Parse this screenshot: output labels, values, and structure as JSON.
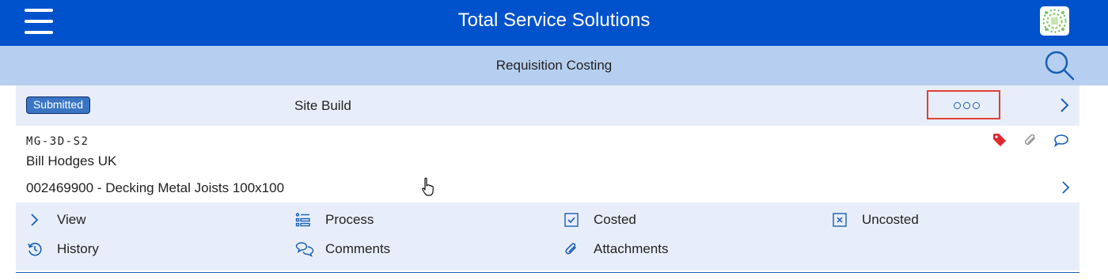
{
  "header": {
    "title": "Total Service Solutions"
  },
  "subheader": {
    "title": "Requisition Costing"
  },
  "card": {
    "status": "Submitted",
    "type": "Site Build",
    "code": "MG-3D-S2",
    "company": "Bill Hodges UK",
    "product_code": "002469900",
    "product_separator": " - ",
    "product_name": "Decking Metal Joists 100x100"
  },
  "actions": [
    {
      "label": "View",
      "icon": "chevron-right-icon"
    },
    {
      "label": "Process",
      "icon": "process-list-icon"
    },
    {
      "label": "Costed",
      "icon": "checkbox-checked-icon"
    },
    {
      "label": "Uncosted",
      "icon": "checkbox-x-icon"
    },
    {
      "label": "History",
      "icon": "history-icon"
    },
    {
      "label": "Comments",
      "icon": "comments-icon"
    },
    {
      "label": "Attachments",
      "icon": "paperclip-icon"
    }
  ],
  "colors": {
    "primary": "#0052cc",
    "subheader": "#b6cff0",
    "card_bg": "#e8eef9",
    "accent": "#1a5fb4",
    "tag": "#e0282e",
    "highlight": "#e0403a"
  }
}
